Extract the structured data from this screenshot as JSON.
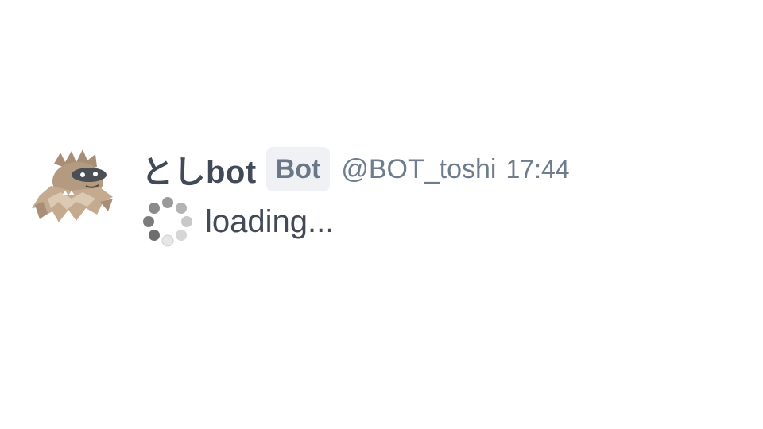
{
  "message": {
    "avatar_icon": "yeti-mascot-avatar",
    "display_name": "としbot",
    "badge": "Bot",
    "handle": "@BOT_toshi",
    "time": "17:44",
    "spinner_icon": "loading-spinner",
    "body_text": "loading..."
  },
  "colors": {
    "name_text": "#414a56",
    "meta_text": "#6f7c8d",
    "badge_bg": "#eff1f4",
    "badge_text": "#6b7787"
  }
}
